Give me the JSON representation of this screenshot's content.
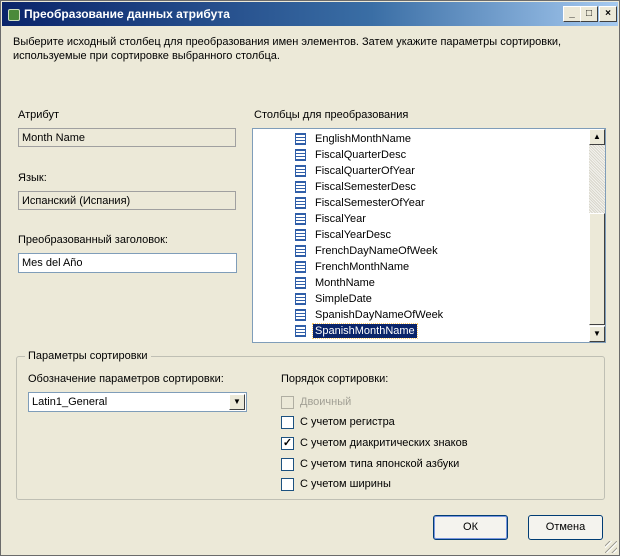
{
  "window": {
    "title": "Преобразование данных атрибута",
    "controls": {
      "minimize": "_",
      "maximize": "□",
      "close": "×"
    }
  },
  "description": "Выберите исходный столбец для преобразования имен элементов. Затем укажите параметры сортировки, используемые при сортировке выбранного столбца.",
  "attribute": {
    "label": "Атрибут",
    "value": "Month Name"
  },
  "language": {
    "label": "Язык:",
    "value": "Испанский (Испания)"
  },
  "translated_caption": {
    "label": "Преобразованный заголовок:",
    "value": "Mes del Año"
  },
  "columns": {
    "label": "Столбцы для преобразования",
    "items": [
      "EnglishMonthName",
      "FiscalQuarterDesc",
      "FiscalQuarterOfYear",
      "FiscalSemesterDesc",
      "FiscalSemesterOfYear",
      "FiscalYear",
      "FiscalYearDesc",
      "FrenchDayNameOfWeek",
      "FrenchMonthName",
      "MonthName",
      "SimpleDate",
      "SpanishDayNameOfWeek",
      "SpanishMonthName"
    ],
    "selected": "SpanishMonthName"
  },
  "sort": {
    "group_title": "Параметры сортировки",
    "collation_label": "Обозначение параметров сортировки:",
    "collation_value": "Latin1_General",
    "order_label": "Порядок сортировки:",
    "options": [
      {
        "label": "Двоичный",
        "checked": false,
        "disabled": true
      },
      {
        "label": "С учетом регистра",
        "checked": false,
        "disabled": false
      },
      {
        "label": "С учетом диакритических знаков",
        "checked": true,
        "disabled": false
      },
      {
        "label": "С учетом типа японской азбуки",
        "checked": false,
        "disabled": false
      },
      {
        "label": "С учетом ширины",
        "checked": false,
        "disabled": false
      }
    ]
  },
  "buttons": {
    "ok": "ОК",
    "cancel": "Отмена"
  },
  "icons": {
    "column": "column-icon",
    "app": "app-icon"
  }
}
